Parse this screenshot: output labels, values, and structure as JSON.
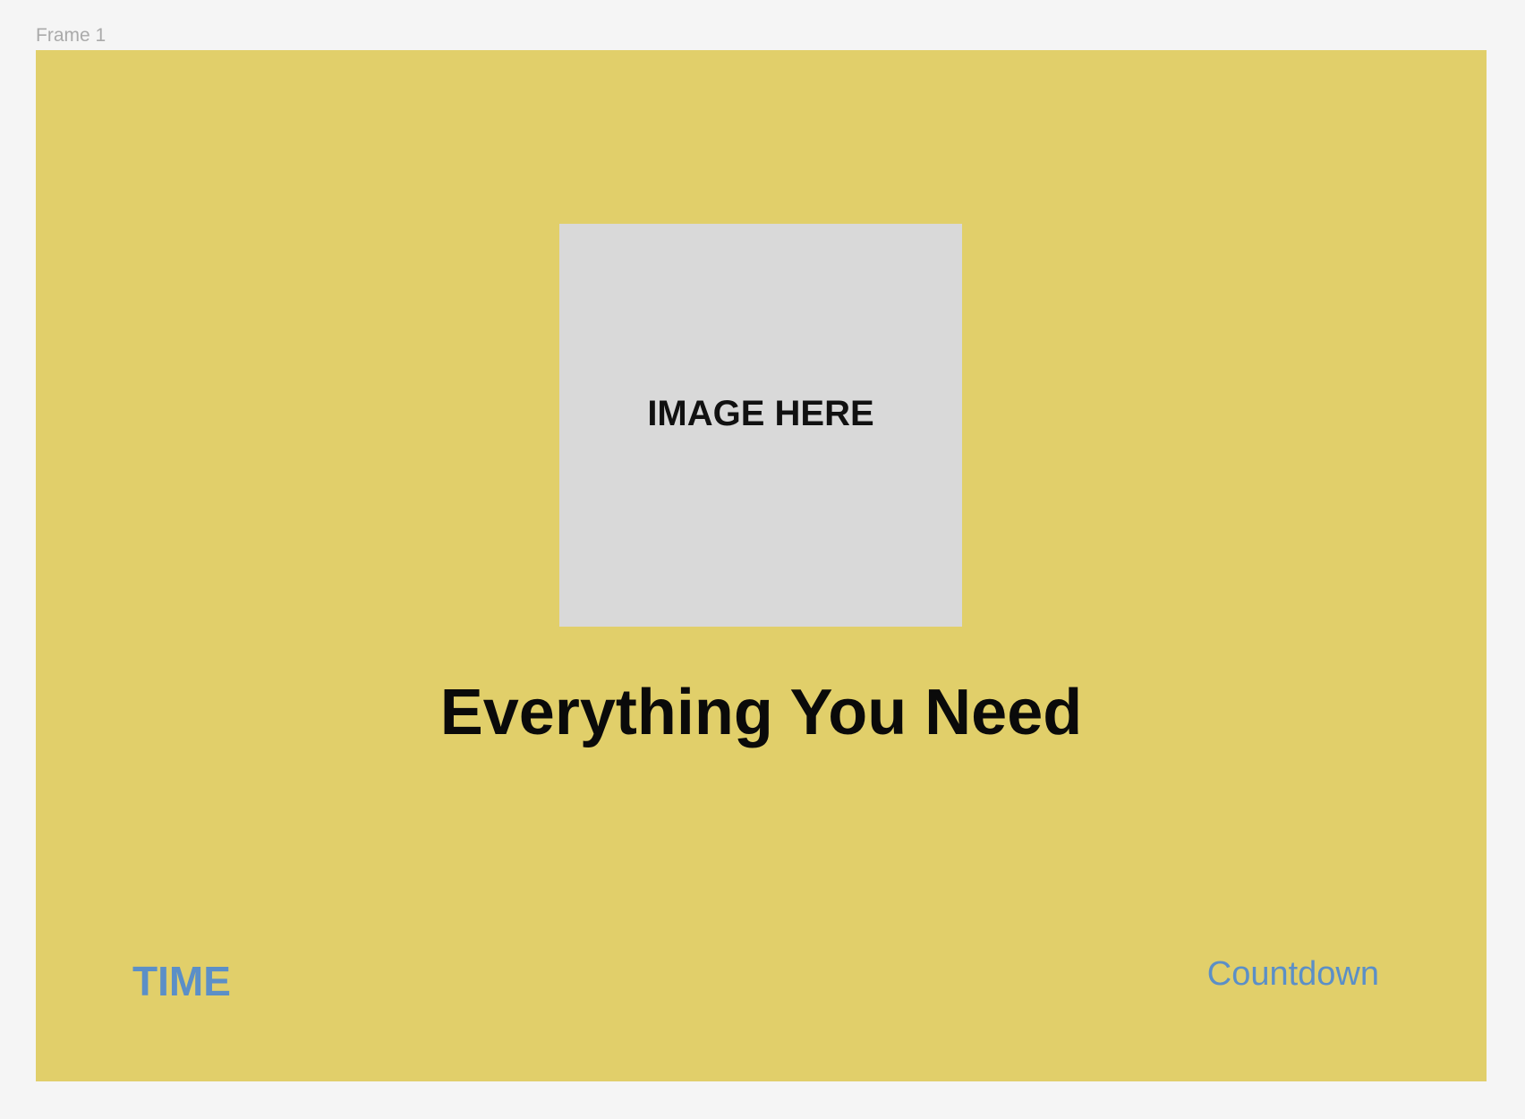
{
  "frame": {
    "label": "Frame 1",
    "background_color": "#e1cf6a"
  },
  "image_placeholder": {
    "text": "IMAGE HERE",
    "background_color": "#d9d9d9"
  },
  "headline": {
    "text": "Everything You Need"
  },
  "footer": {
    "left_text": "TIME",
    "right_text": "Countdown",
    "text_color": "#5b8fc7"
  },
  "canvas": {
    "background_color": "#f5f5f5"
  }
}
